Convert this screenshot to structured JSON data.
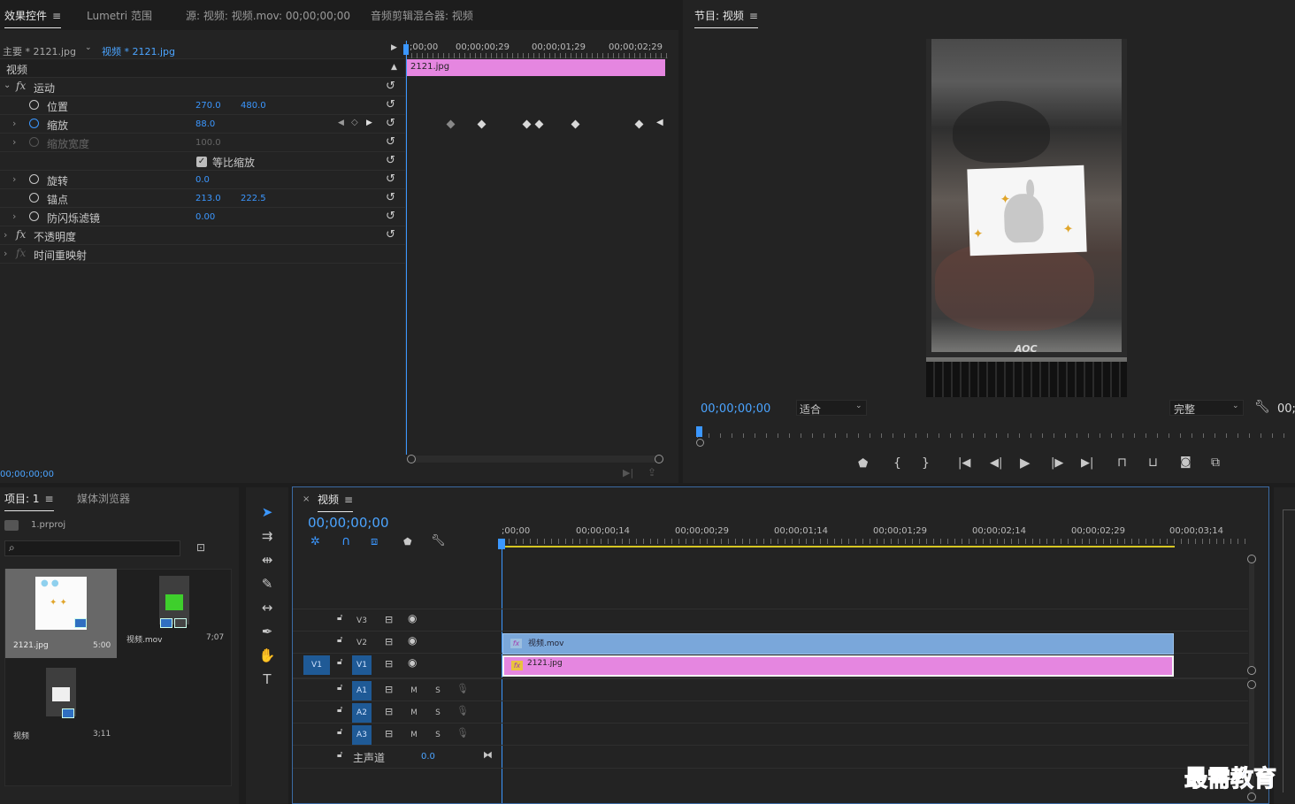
{
  "effect_panel": {
    "tabs": [
      "效果控件",
      "Lumetri 范围",
      "源: 视频: 视频.mov: 00;00;00;00",
      "音频剪辑混合器: 视频"
    ],
    "master_label": "主要 * 2121.jpg",
    "clip_label": "视频 * 2121.jpg",
    "section_video": "视频",
    "motion": "运动",
    "position_label": "位置",
    "position_x": "270.0",
    "position_y": "480.0",
    "scale_label": "缩放",
    "scale_value": "88.0",
    "scale_width_label": "缩放宽度",
    "scale_width_value": "100.0",
    "uniform_scale": "等比缩放",
    "rotation_label": "旋转",
    "rotation_value": "0.0",
    "anchor_label": "锚点",
    "anchor_x": "213.0",
    "anchor_y": "222.5",
    "flicker_label": "防闪烁滤镜",
    "flicker_value": "0.00",
    "opacity": "不透明度",
    "time_remap": "时间重映射",
    "ruler": [
      ";00;00",
      "00;00;00;29",
      "00;00;01;29",
      "00;00;02;29"
    ],
    "clip_name": "2121.jpg",
    "timecode": "00;00;00;00"
  },
  "program_monitor": {
    "title": "节目: 视频",
    "timecode": "00;00;00;00",
    "fit": "适合",
    "quality": "完整",
    "right_tc": "00;",
    "brand": "AOC"
  },
  "project_panel": {
    "tabs": [
      "项目: 1",
      "媒体浏览器"
    ],
    "project_file": "1.prproj",
    "search_placeholder": "",
    "items": [
      {
        "name": "2121.jpg",
        "duration": "5:00"
      },
      {
        "name": "视频.mov",
        "duration": "7;07"
      },
      {
        "name": "视频",
        "duration": "3;11"
      }
    ]
  },
  "timeline": {
    "title": "视频",
    "timecode": "00;00;00;00",
    "ruler": [
      ";00;00",
      "00;00;00;14",
      "00;00;00;29",
      "00;00;01;14",
      "00;00;01;29",
      "00;00;02;14",
      "00;00;02;29",
      "00;00;03;14"
    ],
    "video_tracks": [
      "V3",
      "V2",
      "V1"
    ],
    "source_patch": "V1",
    "audio_tracks": [
      "A1",
      "A2",
      "A3"
    ],
    "mute": "M",
    "solo": "S",
    "master": "主声道",
    "master_value": "0.0",
    "clip_v2": "视频.mov",
    "clip_v1": "2121.jpg"
  },
  "watermark": "最需教育",
  "colors": {
    "accent": "#3b97ff",
    "clip_image": "#e586e0",
    "clip_video": "#7aa7da",
    "panel": "#232323"
  }
}
